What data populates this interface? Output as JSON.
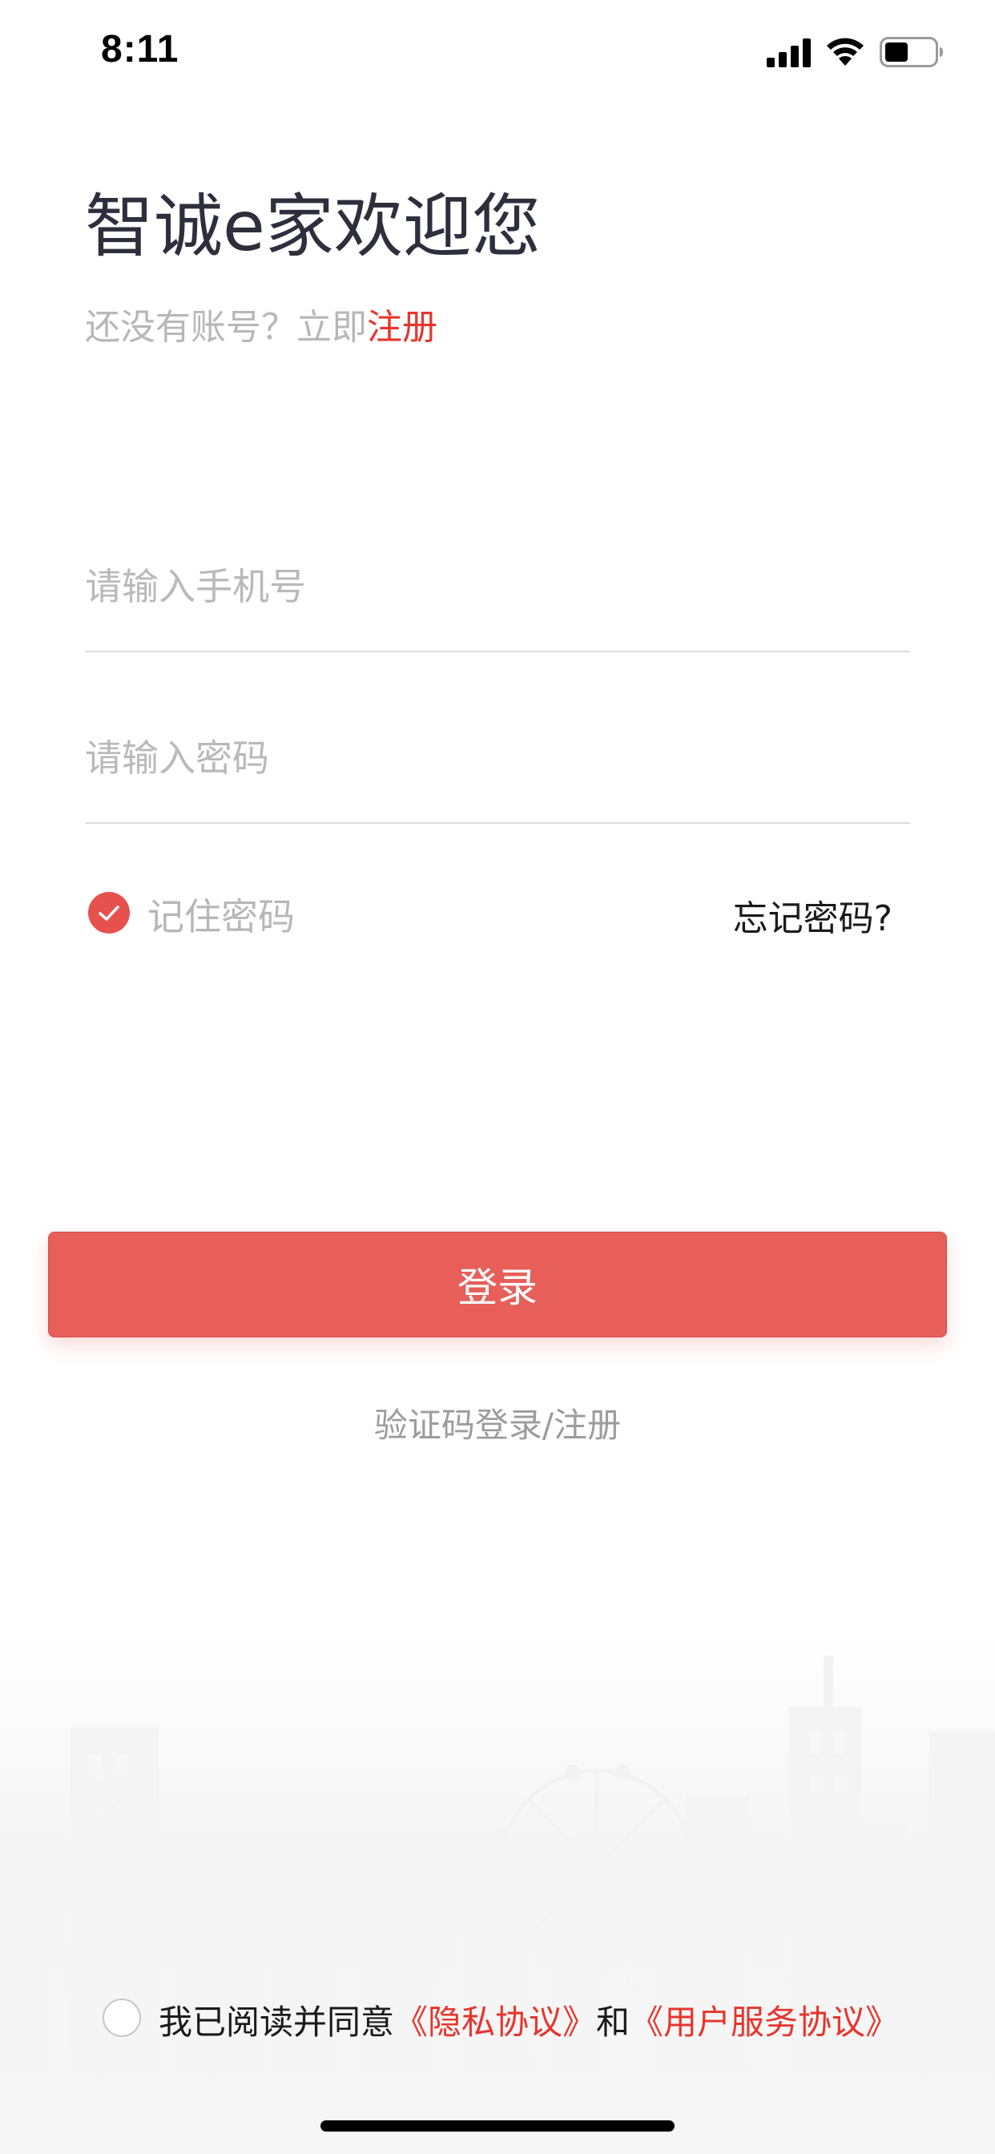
{
  "status_bar": {
    "time": "8:11",
    "icons": [
      "signal-icon",
      "wifi-icon",
      "battery-icon"
    ]
  },
  "header": {
    "title": "智诚e家欢迎您",
    "subtitle_prefix": "还没有账号？立即",
    "register_link": "注册"
  },
  "form": {
    "phone_placeholder": "请输入手机号",
    "password_placeholder": "请输入密码",
    "remember_label": "记住密码",
    "remember_checked": true,
    "forgot_link": "忘记密码?"
  },
  "actions": {
    "login_label": "登录",
    "sms_login_label": "验证码登录/注册"
  },
  "agreement": {
    "checked": false,
    "prefix": "我已阅读并同意",
    "privacy_link": "《隐私协议》",
    "conjunction": "和",
    "service_link": "《用户服务协议》"
  },
  "colors": {
    "accent": "#e85e59",
    "link": "#e7352d",
    "title": "#2e2f3d",
    "muted": "#b7b7b7"
  }
}
